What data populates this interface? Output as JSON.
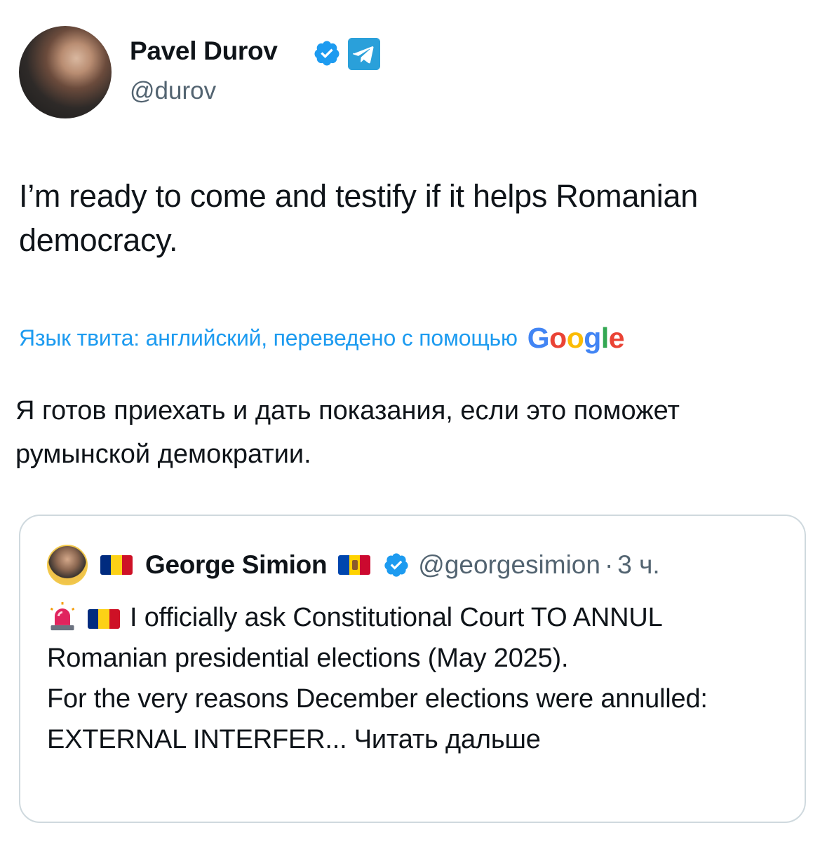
{
  "author": {
    "name": "Pavel Durov",
    "handle": "@durov"
  },
  "tweet": {
    "text": "I’m ready to come and testify if it helps Romanian democracy."
  },
  "translation": {
    "label": "Язык твита: английский, переведено с помощью",
    "provider": "Google",
    "text": "Я готов приехать и дать показания, если это поможет румынской демократии."
  },
  "quoted_tweet": {
    "author_name": "George Simion",
    "handle": "@georgesimion",
    "separator": "·",
    "time": "3 ч.",
    "text_line1": "I officially ask Constitutional Court TO ANNUL Romanian presidential elections (May 2025).",
    "text_line2": "For the very reasons December elections were annulled: EXTERNAL INTERFER...",
    "read_more": "Читать дальше"
  },
  "icons": {
    "verified": "verified-badge-icon",
    "telegram": "telegram-icon",
    "siren": "siren-icon",
    "flag_romania": "romania-flag-icon",
    "flag_moldova": "moldova-flag-icon"
  },
  "colors": {
    "accent": "#1d9bf0",
    "text_primary": "#0f1419",
    "text_secondary": "#536471",
    "border": "#cfd9de",
    "telegram": "#2aa0da"
  }
}
